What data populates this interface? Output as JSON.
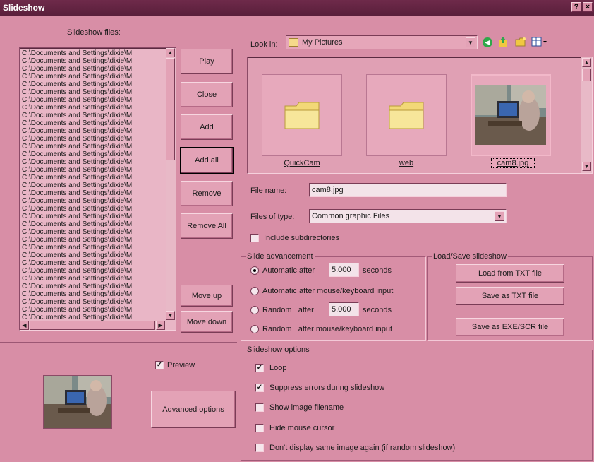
{
  "window": {
    "title": "Slideshow",
    "help_glyph": "?",
    "close_glyph": "×"
  },
  "left": {
    "files_label": "Slideshow files:",
    "files": [
      "C:\\Documents and Settings\\dixie\\M",
      "C:\\Documents and Settings\\dixie\\M",
      "C:\\Documents and Settings\\dixie\\M",
      "C:\\Documents and Settings\\dixie\\M",
      "C:\\Documents and Settings\\dixie\\M",
      "C:\\Documents and Settings\\dixie\\M",
      "C:\\Documents and Settings\\dixie\\M",
      "C:\\Documents and Settings\\dixie\\M",
      "C:\\Documents and Settings\\dixie\\M",
      "C:\\Documents and Settings\\dixie\\M",
      "C:\\Documents and Settings\\dixie\\M",
      "C:\\Documents and Settings\\dixie\\M",
      "C:\\Documents and Settings\\dixie\\M",
      "C:\\Documents and Settings\\dixie\\M",
      "C:\\Documents and Settings\\dixie\\M",
      "C:\\Documents and Settings\\dixie\\M",
      "C:\\Documents and Settings\\dixie\\M",
      "C:\\Documents and Settings\\dixie\\M",
      "C:\\Documents and Settings\\dixie\\M",
      "C:\\Documents and Settings\\dixie\\M",
      "C:\\Documents and Settings\\dixie\\M",
      "C:\\Documents and Settings\\dixie\\M",
      "C:\\Documents and Settings\\dixie\\M",
      "C:\\Documents and Settings\\dixie\\M",
      "C:\\Documents and Settings\\dixie\\M",
      "C:\\Documents and Settings\\dixie\\M",
      "C:\\Documents and Settings\\dixie\\M",
      "C:\\Documents and Settings\\dixie\\M",
      "C:\\Documents and Settings\\dixie\\M",
      "C:\\Documents and Settings\\dixie\\M",
      "C:\\Documents and Settings\\dixie\\M",
      "C:\\Documents and Settings\\dixie\\M",
      "C:\\Documents and Settings\\dixie\\M",
      "C:\\Documents and Settings\\dixie\\M",
      "C:\\Documents and Settings\\dixie\\M"
    ],
    "buttons": {
      "play": "Play",
      "close": "Close",
      "add": "Add",
      "add_all": "Add all",
      "remove": "Remove",
      "remove_all": "Remove All",
      "move_up": "Move up",
      "move_down": "Move down"
    },
    "preview_label": "Preview",
    "preview_checked": true,
    "advanced_options": "Advanced options"
  },
  "browser": {
    "look_in_label": "Look in:",
    "look_in_value": "My Pictures",
    "items": [
      {
        "name": "QuickCam",
        "kind": "folder",
        "selected": false
      },
      {
        "name": "web",
        "kind": "folder",
        "selected": false
      },
      {
        "name": "cam8.jpg",
        "kind": "image",
        "selected": true
      }
    ],
    "file_name_label": "File name:",
    "file_name_value": "cam8.jpg",
    "files_of_type_label": "Files of type:",
    "files_of_type_value": "Common graphic Files",
    "include_subdirs_label": "Include subdirectories",
    "include_subdirs_checked": false
  },
  "advancement": {
    "group_label": "Slide advancement",
    "auto_after_label": "Automatic after",
    "auto_seconds": "5.000",
    "seconds_label": "seconds",
    "auto_input_label": "Automatic after mouse/keyboard input",
    "random_after_label": "Random   after",
    "random_seconds": "5.000",
    "random_input_label": "Random   after mouse/keyboard input",
    "selected": "auto_after"
  },
  "load_save": {
    "group_label": "Load/Save slideshow",
    "load_txt": "Load from TXT file",
    "save_txt": "Save as  TXT file",
    "save_exe": "Save as  EXE/SCR file"
  },
  "options": {
    "group_label": "Slideshow options",
    "loop": {
      "label": "Loop",
      "checked": true
    },
    "suppress": {
      "label": "Suppress errors during slideshow",
      "checked": true
    },
    "show_filename": {
      "label": "Show image filename",
      "checked": false
    },
    "hide_cursor": {
      "label": "Hide mouse cursor",
      "checked": false
    },
    "no_repeat": {
      "label": "Don't display same image again (if random slideshow)",
      "checked": false
    }
  },
  "colors": {
    "background": "#d88ea6",
    "titlebar": "#5a1f3b",
    "list": "#e9b6c6"
  },
  "icons": [
    "back-arrow-icon",
    "up-folder-icon",
    "new-folder-icon",
    "view-menu-icon",
    "folder-icon",
    "check-mark-icon"
  ]
}
